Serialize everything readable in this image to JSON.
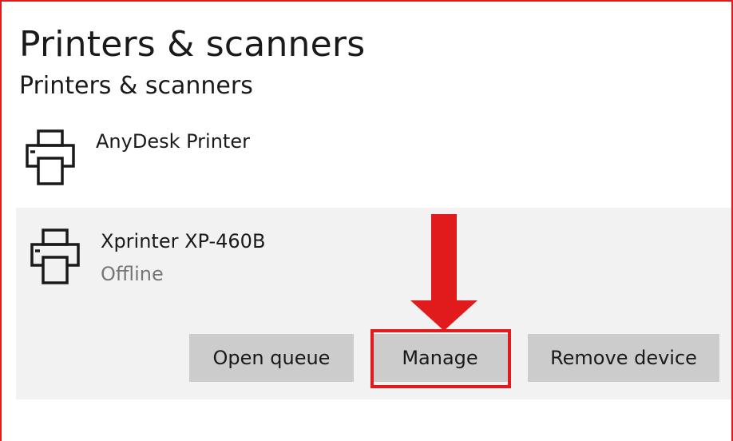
{
  "page": {
    "title": "Printers & scanners",
    "section_title": "Printers & scanners"
  },
  "devices": [
    {
      "name": "AnyDesk Printer",
      "icon": "printer-icon"
    },
    {
      "name": "Xprinter XP-460B",
      "status": "Offline",
      "icon": "printer-icon",
      "selected": true,
      "actions": {
        "open_queue": "Open queue",
        "manage": "Manage",
        "remove_device": "Remove device"
      }
    }
  ],
  "annotation": {
    "highlight_color": "#e11b1b",
    "arrow_color": "#e11b1b",
    "target": "manage-button"
  },
  "colors": {
    "selected_row_bg": "#f2f2f2",
    "button_bg": "#cccccc",
    "status_text": "#767676"
  }
}
